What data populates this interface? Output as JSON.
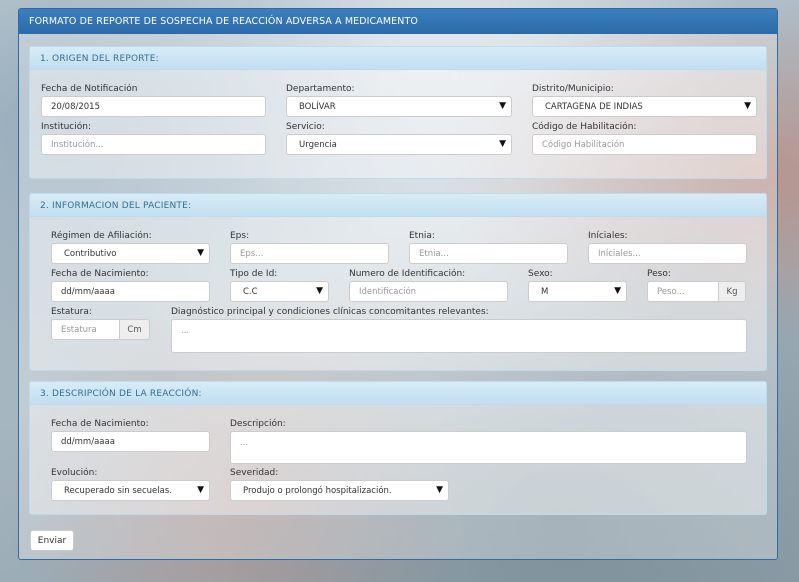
{
  "form": {
    "title": "FORMATO DE REPORTE DE SOSPECHA DE REACCIÓN ADVERSA A MEDICAMENTO",
    "submit_label": "Enviar"
  },
  "s1": {
    "title": "1. ORIGEN DEL REPORTE:",
    "fecha_label": "Fecha de Notificación",
    "fecha_value": "20/08/2015",
    "depto_label": "Departamento:",
    "depto_value": "BOLÍVAR",
    "distrito_label": "Distrito/Municipio:",
    "distrito_value": "CARTAGENA DE INDIAS",
    "inst_label": "Institución:",
    "inst_placeholder": "Institución...",
    "serv_label": "Servicio:",
    "serv_value": "Urgencia",
    "cod_label": "Código de Habilitación:",
    "cod_placeholder": "Código Habilitación"
  },
  "s2": {
    "title": "2. INFORMACION DEL PACIENTE:",
    "regimen_label": "Régimen de Afiliación:",
    "regimen_value": "Contributivo",
    "eps_label": "Eps:",
    "eps_placeholder": "Eps...",
    "etnia_label": "Etnia:",
    "etnia_placeholder": "Etnia...",
    "iniciales_label": "Iníciales:",
    "iniciales_placeholder": "Iníciales...",
    "nac_label": "Fecha de Nacimiento:",
    "nac_placeholder": "dd/mm/aaaa",
    "tipo_label": "Tipo de Id:",
    "tipo_value": "C.C",
    "numid_label": "Numero de Identificación:",
    "numid_placeholder": "Identificación",
    "sexo_label": "Sexo:",
    "sexo_value": "M",
    "peso_label": "Peso:",
    "peso_placeholder": "Peso...",
    "peso_unit": "Kg",
    "estatura_label": "Estatura:",
    "estatura_placeholder": "Estatura",
    "estatura_unit": "Cm",
    "diag_label": "Diagnóstico principal y condiciones clínicas concomitantes relevantes:",
    "diag_placeholder": "..."
  },
  "s3": {
    "title": "3. DESCRIPCIÓN DE LA REACCIÓN:",
    "nac_label": "Fecha de Nacimiento:",
    "nac_placeholder": "dd/mm/aaaa",
    "desc_label": "Descripción:",
    "desc_placeholder": "...",
    "evol_label": "Evolución:",
    "evol_value": "Recuperado sin secuelas.",
    "sev_label": "Severidad:",
    "sev_value": "Produjo o prolongó hospitalización."
  },
  "icons": {
    "dropdown_arrow": "▼"
  }
}
